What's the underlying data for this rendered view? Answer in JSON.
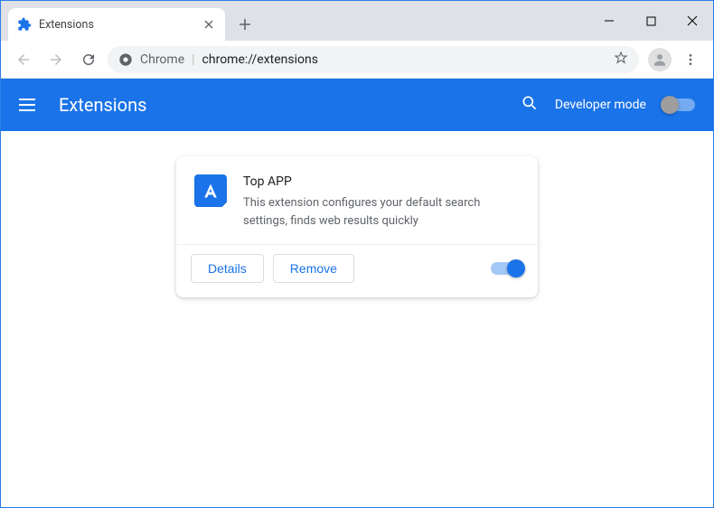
{
  "window": {
    "tab": {
      "title": "Extensions"
    }
  },
  "omnibox": {
    "prefix": "Chrome",
    "url": "chrome://extensions"
  },
  "header": {
    "title": "Extensions",
    "developer_mode_label": "Developer mode",
    "developer_mode_on": false
  },
  "extension": {
    "name": "Top APP",
    "description": "This extension configures your default search settings, finds web results quickly",
    "enabled": true,
    "buttons": {
      "details": "Details",
      "remove": "Remove"
    }
  }
}
